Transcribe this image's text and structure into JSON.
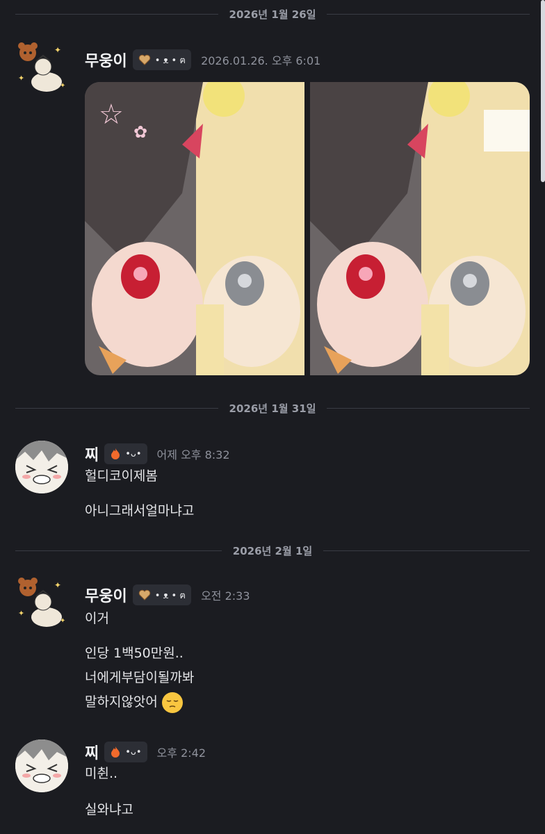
{
  "dividers": [
    "2026년 1월 26일",
    "2026년 1월 31일",
    "2026년 2월 1일"
  ],
  "messages": [
    {
      "author": "무웅이",
      "badge": "• ᴥ • ฅ",
      "time": "2026.01.26. 오후 6:01",
      "attachment": "two-panel-illustration"
    },
    {
      "author": "찌",
      "badge": "•ᴗ•",
      "time": "어제 오후 8:32",
      "lines": [
        "헐디코이제봄",
        "아니그래서얼마냐고"
      ]
    },
    {
      "author": "무웅이",
      "badge": "• ᴥ • ฅ",
      "time": "오전 2:33",
      "lines": [
        "이거",
        "인당 1백50만원..",
        "너에게부담이될까봐",
        "말하지않앗어"
      ]
    },
    {
      "author": "찌",
      "badge": "•ᴗ•",
      "time": "오후 2:42",
      "lines": [
        "미췬..",
        "실와냐고"
      ]
    }
  ],
  "colors": {
    "background": "#1b1c21",
    "divider": "#3a3c44",
    "timestamp": "#8f929c"
  }
}
